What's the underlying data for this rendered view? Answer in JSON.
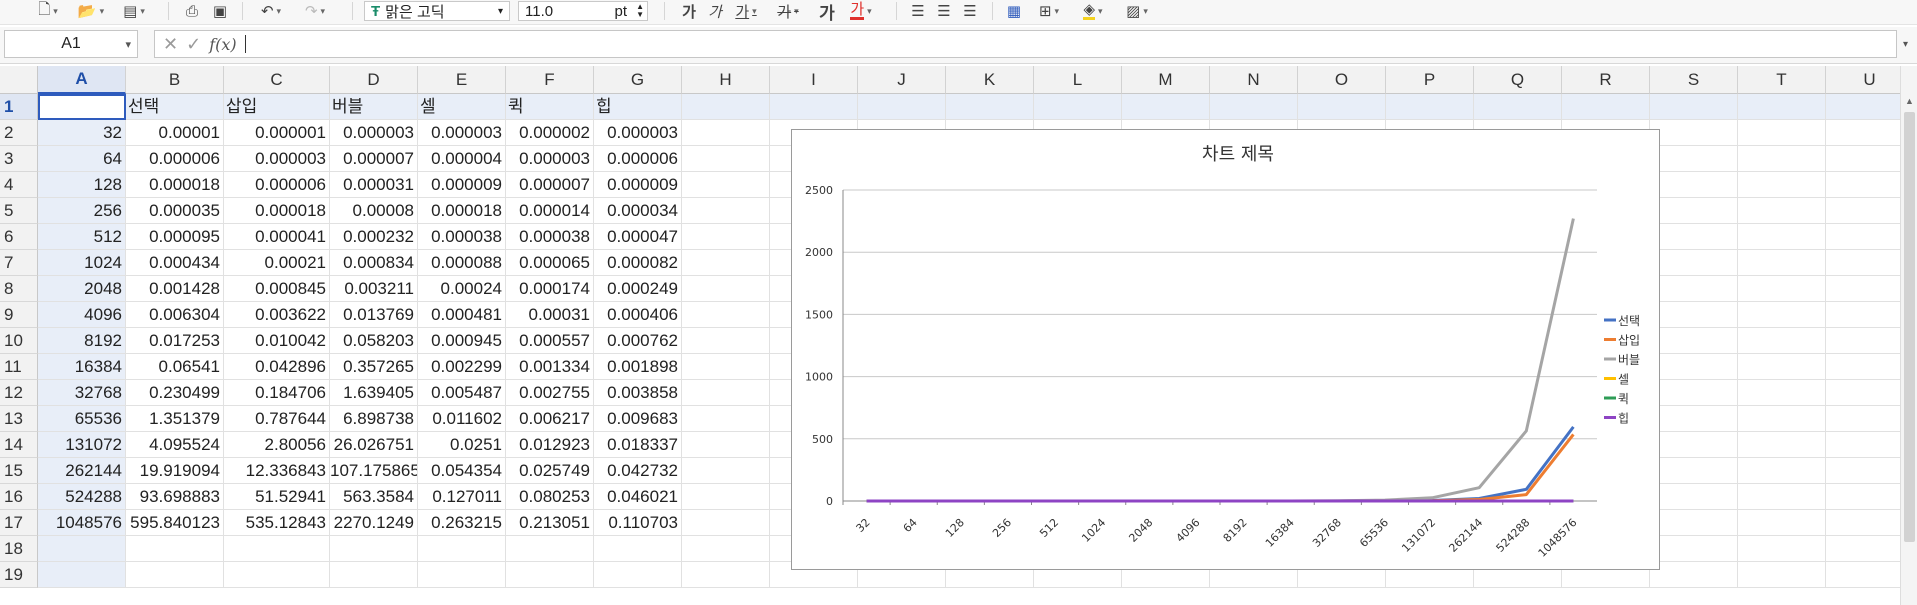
{
  "toolbar": {
    "font_name": "맑은 고딕",
    "font_size": "11.0",
    "font_unit": "pt",
    "font_color": "#e0302c",
    "fill_color": "#f4d21f"
  },
  "formula_bar": {
    "name_box": "A1",
    "fx_label": "f(x)",
    "content": ""
  },
  "columns": [
    "A",
    "B",
    "C",
    "D",
    "E",
    "F",
    "G",
    "H",
    "I",
    "J",
    "K",
    "L",
    "M",
    "N",
    "O",
    "P",
    "Q",
    "R",
    "S",
    "T",
    "U"
  ],
  "rows": [
    "1",
    "2",
    "3",
    "4",
    "5",
    "6",
    "7",
    "8",
    "9",
    "10",
    "11",
    "12",
    "13",
    "14",
    "15",
    "16",
    "17",
    "18",
    "19"
  ],
  "headers": [
    "",
    "선택",
    "삽입",
    "버블",
    "셀",
    "퀵",
    "힙"
  ],
  "table": [
    [
      "32",
      "0.00001",
      "0.000001",
      "0.000003",
      "0.000003",
      "0.000002",
      "0.000003"
    ],
    [
      "64",
      "0.000006",
      "0.000003",
      "0.000007",
      "0.000004",
      "0.000003",
      "0.000006"
    ],
    [
      "128",
      "0.000018",
      "0.000006",
      "0.000031",
      "0.000009",
      "0.000007",
      "0.000009"
    ],
    [
      "256",
      "0.000035",
      "0.000018",
      "0.00008",
      "0.000018",
      "0.000014",
      "0.000034"
    ],
    [
      "512",
      "0.000095",
      "0.000041",
      "0.000232",
      "0.000038",
      "0.000038",
      "0.000047"
    ],
    [
      "1024",
      "0.000434",
      "0.00021",
      "0.000834",
      "0.000088",
      "0.000065",
      "0.000082"
    ],
    [
      "2048",
      "0.001428",
      "0.000845",
      "0.003211",
      "0.00024",
      "0.000174",
      "0.000249"
    ],
    [
      "4096",
      "0.006304",
      "0.003622",
      "0.013769",
      "0.000481",
      "0.00031",
      "0.000406"
    ],
    [
      "8192",
      "0.017253",
      "0.010042",
      "0.058203",
      "0.000945",
      "0.000557",
      "0.000762"
    ],
    [
      "16384",
      "0.06541",
      "0.042896",
      "0.357265",
      "0.002299",
      "0.001334",
      "0.001898"
    ],
    [
      "32768",
      "0.230499",
      "0.184706",
      "1.639405",
      "0.005487",
      "0.002755",
      "0.003858"
    ],
    [
      "65536",
      "1.351379",
      "0.787644",
      "6.898738",
      "0.011602",
      "0.006217",
      "0.009683"
    ],
    [
      "131072",
      "4.095524",
      "2.80056",
      "26.026751",
      "0.0251",
      "0.012923",
      "0.018337"
    ],
    [
      "262144",
      "19.919094",
      "12.336843",
      "107.175865",
      "0.054354",
      "0.025749",
      "0.042732"
    ],
    [
      "524288",
      "93.698883",
      "51.52941",
      "563.3584",
      "0.127011",
      "0.080253",
      "0.046021"
    ],
    [
      "1048576",
      "595.840123",
      "535.12843",
      "2270.1249",
      "0.263215",
      "0.213051",
      "0.110703"
    ]
  ],
  "chart_data": {
    "type": "line",
    "title": "차트 제목",
    "categories": [
      "32",
      "64",
      "128",
      "256",
      "512",
      "1024",
      "2048",
      "4096",
      "8192",
      "16384",
      "32768",
      "65536",
      "131072",
      "262144",
      "524288",
      "1048576"
    ],
    "ylim": [
      0,
      2500
    ],
    "yticks": [
      "0",
      "500",
      "1000",
      "1500",
      "2000",
      "2500"
    ],
    "grid": true,
    "legend_position": "right",
    "series": [
      {
        "name": "선택",
        "color": "#4472c4",
        "values": [
          1e-05,
          6e-06,
          1.8e-05,
          3.5e-05,
          9.5e-05,
          0.000434,
          0.001428,
          0.006304,
          0.017253,
          0.06541,
          0.230499,
          1.351379,
          4.095524,
          19.919094,
          93.698883,
          595.840123
        ]
      },
      {
        "name": "삽입",
        "color": "#ed7d31",
        "values": [
          1e-06,
          3e-06,
          6e-06,
          1.8e-05,
          4.1e-05,
          0.00021,
          0.000845,
          0.003622,
          0.010042,
          0.042896,
          0.184706,
          0.787644,
          2.80056,
          12.336843,
          51.52941,
          535.12843
        ]
      },
      {
        "name": "버블",
        "color": "#a5a5a5",
        "values": [
          3e-06,
          7e-06,
          3.1e-05,
          8e-05,
          0.000232,
          0.000834,
          0.003211,
          0.013769,
          0.058203,
          0.357265,
          1.639405,
          6.898738,
          26.026751,
          107.175865,
          563.3584,
          2270.1249
        ]
      },
      {
        "name": "셀",
        "color": "#ffc000",
        "values": [
          3e-06,
          4e-06,
          9e-06,
          1.8e-05,
          3.8e-05,
          8.8e-05,
          0.00024,
          0.000481,
          0.000945,
          0.002299,
          0.005487,
          0.011602,
          0.0251,
          0.054354,
          0.127011,
          0.263215
        ]
      },
      {
        "name": "퀵",
        "color": "#2e9c56",
        "values": [
          2e-06,
          3e-06,
          7e-06,
          1.4e-05,
          3.8e-05,
          6.5e-05,
          0.000174,
          0.00031,
          0.000557,
          0.001334,
          0.002755,
          0.006217,
          0.012923,
          0.025749,
          0.080253,
          0.213051
        ]
      },
      {
        "name": "힙",
        "color": "#8e44c4",
        "values": [
          3e-06,
          6e-06,
          9e-06,
          3.4e-05,
          4.7e-05,
          8.2e-05,
          0.000249,
          0.000406,
          0.000762,
          0.001898,
          0.003858,
          0.009683,
          0.018337,
          0.042732,
          0.046021,
          0.110703
        ]
      }
    ]
  }
}
